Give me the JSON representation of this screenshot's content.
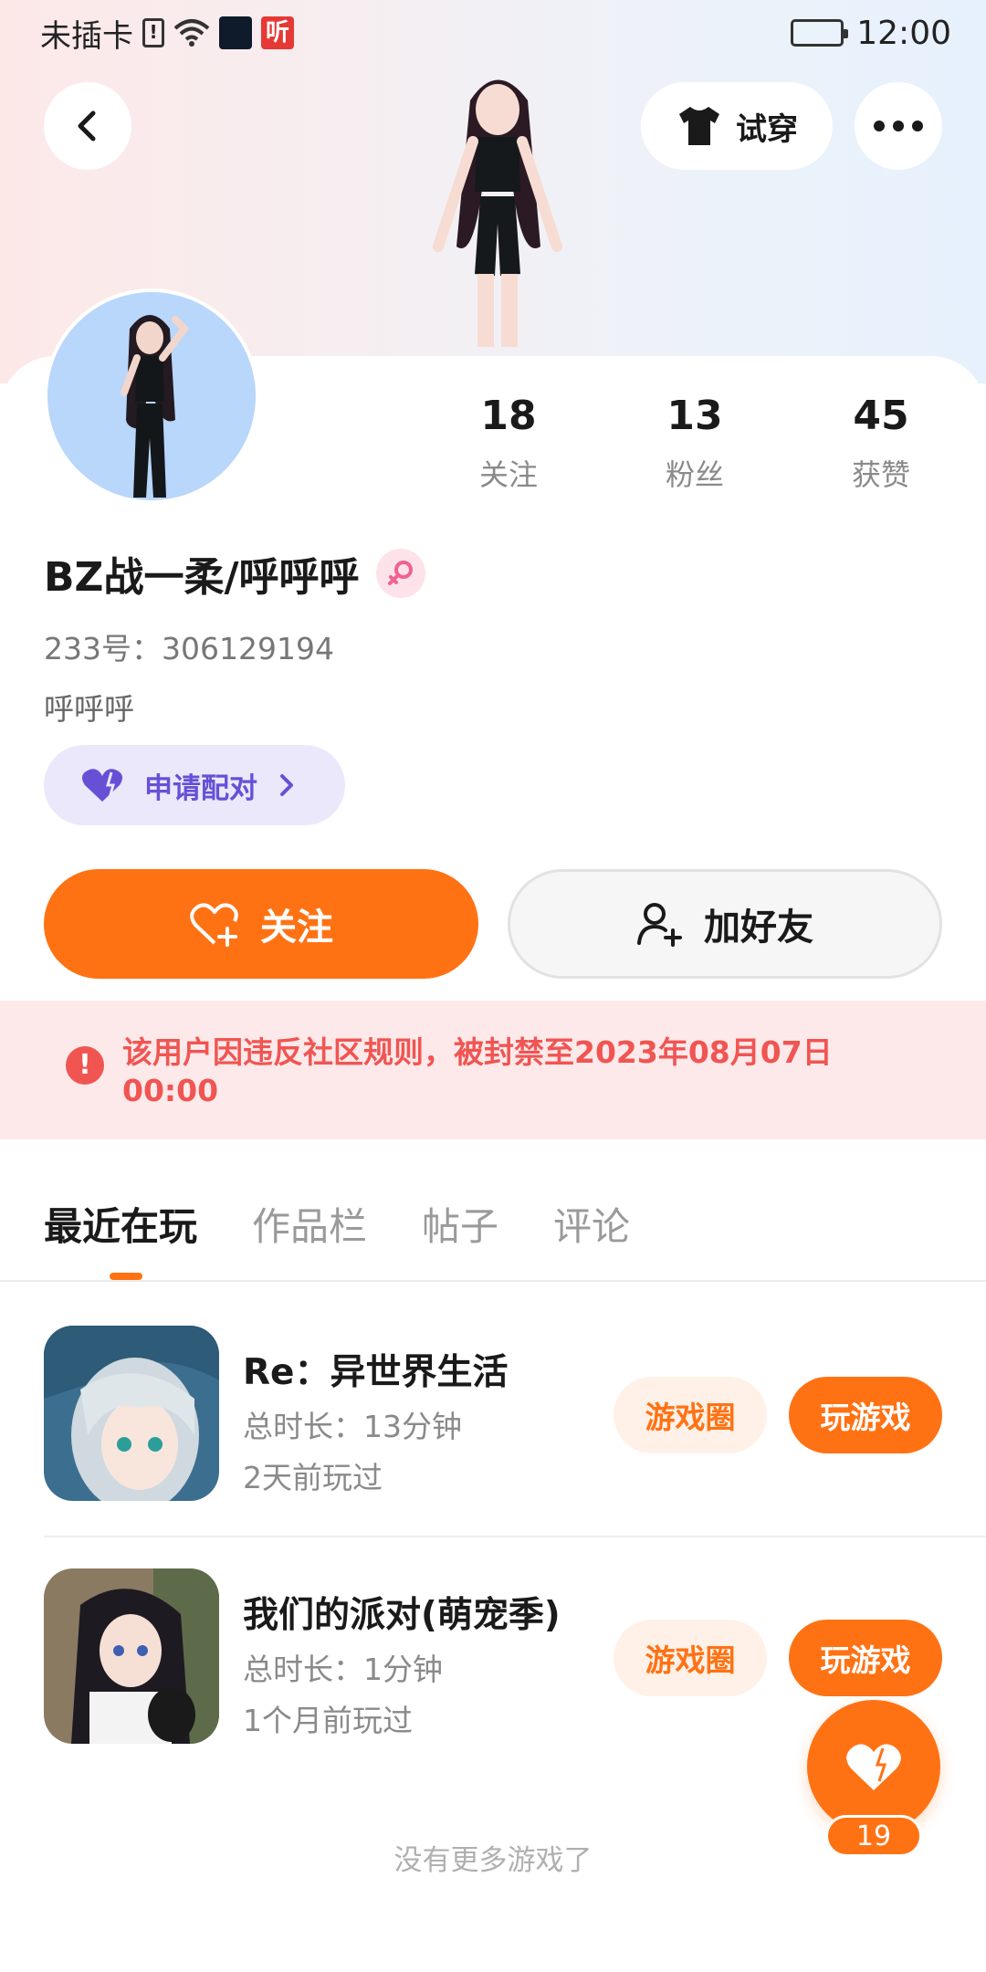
{
  "status_bar": {
    "carrier": "未插卡",
    "app_icon_badge": "听",
    "time": "12:00"
  },
  "header": {
    "tryon_label": "试穿"
  },
  "profile": {
    "stats": [
      {
        "value": "18",
        "label": "关注"
      },
      {
        "value": "13",
        "label": "粉丝"
      },
      {
        "value": "45",
        "label": "获赞"
      }
    ],
    "username": "BZ战一柔/呼呼呼",
    "uid": "233号：306129194",
    "bio": "呼呼呼",
    "pair_label": "申请配对"
  },
  "actions": {
    "follow_label": "关注",
    "add_friend_label": "加好友"
  },
  "ban_notice": {
    "text": "该用户因违反社区规则，被封禁至2023年08月07日 00:00"
  },
  "tabs": [
    {
      "label": "最近在玩",
      "active": true
    },
    {
      "label": "作品栏",
      "active": false
    },
    {
      "label": "帖子",
      "active": false
    },
    {
      "label": "评论",
      "active": false
    }
  ],
  "games": [
    {
      "name": "Re：异世界生活",
      "duration": "总时长：13分钟",
      "last_played": "2天前玩过",
      "circle_label": "游戏圈",
      "play_label": "玩游戏"
    },
    {
      "name": "我们的派对(萌宠季)",
      "duration": "总时长：1分钟",
      "last_played": "1个月前玩过",
      "circle_label": "游戏圈",
      "play_label": "玩游戏"
    }
  ],
  "like_fab": {
    "count": "19"
  },
  "footer": {
    "no_more": "没有更多游戏了"
  },
  "colors": {
    "accent": "#ff7214",
    "ban_red": "#f05552",
    "pair_purple": "#6750d6"
  }
}
